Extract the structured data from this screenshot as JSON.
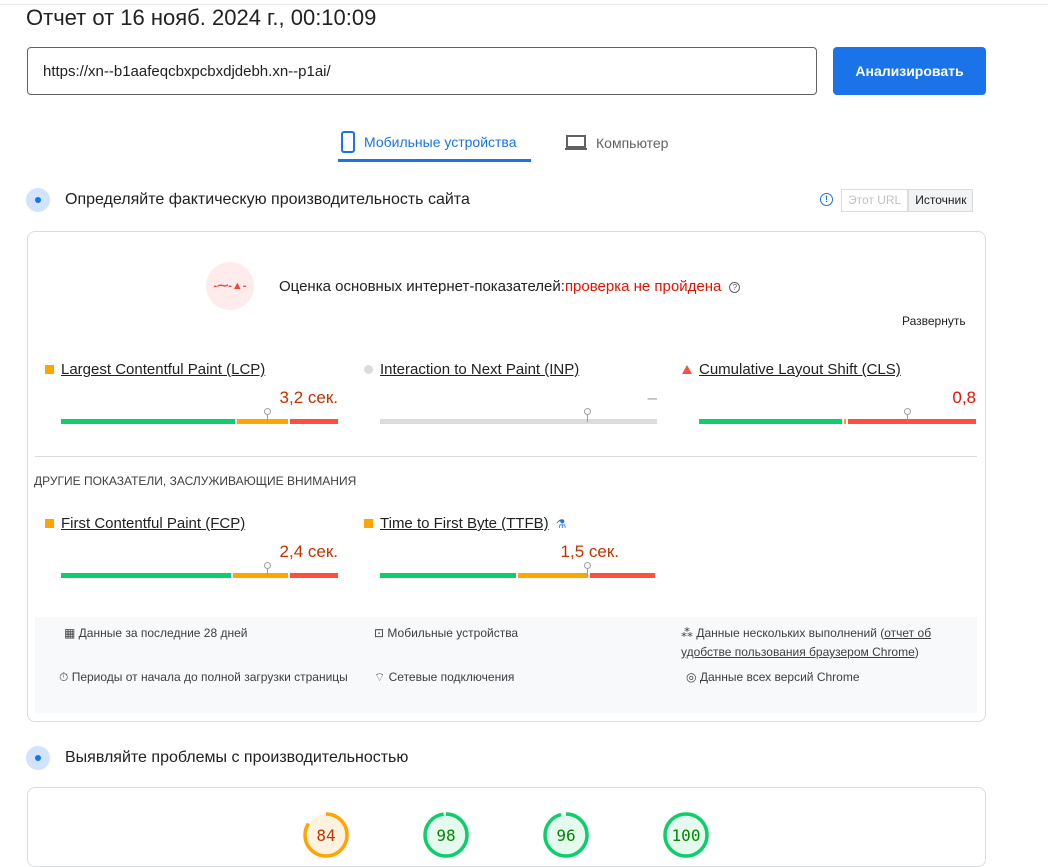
{
  "title": "Отчет от 16 нояб. 2024 г., 00:10:09",
  "url_value": "https://xn--b1aafeqcbxpcbxdjdebh.xn--p1ai/",
  "analyze_label": "Анализировать",
  "tabs": [
    {
      "label": "Мобильные устройства",
      "active": true
    },
    {
      "label": "Компьютер",
      "active": false
    }
  ],
  "field": {
    "heading": "Определяйте фактическую производительность сайта",
    "toggle": {
      "this_url": "Этот URL",
      "source": "Источник"
    },
    "cwv_label": "Оценка основных интернет-показателей:",
    "cwv_status": "проверка не пройдена",
    "expand": "Развернуть",
    "metrics": [
      {
        "name": "Largest Contentful Paint (LCP)",
        "value": "3,2 сек.",
        "rating": "average"
      },
      {
        "name": "Interaction to Next Paint (INP)",
        "value": "–",
        "rating": "none"
      },
      {
        "name": "Cumulative Layout Shift (CLS)",
        "value": "0,8",
        "rating": "poor"
      }
    ],
    "other_heading": "ДРУГИЕ ПОКАЗАТЕЛИ, ЗАСЛУЖИВАЮЩИЕ ВНИМАНИЯ",
    "other_metrics": [
      {
        "name": "First Contentful Paint (FCP)",
        "value": "2,4 сек.",
        "rating": "average"
      },
      {
        "name": "Time to First Byte (TTFB)",
        "value": "1,5 сек.",
        "rating": "average"
      }
    ],
    "info": {
      "period": "Данные за последние 28 дней",
      "device": "Мобильные устройства",
      "runs_prefix": "Данные нескольких выполнений (",
      "runs_link": "отчет об удобстве пользования браузером Chrome",
      "runs_suffix": ")",
      "durations": "Периоды от начала до полной загрузки страницы",
      "network": "Сетевые подключения",
      "chrome": "Данные всех версий Chrome"
    }
  },
  "lab": {
    "heading": "Выявляйте проблемы с производительностью",
    "scores": [
      84,
      98,
      96,
      100
    ]
  },
  "colors": {
    "accent": "#1a73e8",
    "good": "#0cce6b",
    "average": "#ffa400",
    "poor": "#ff4e42",
    "fail_text": "#eb0f00",
    "avg_text": "#c33300"
  }
}
